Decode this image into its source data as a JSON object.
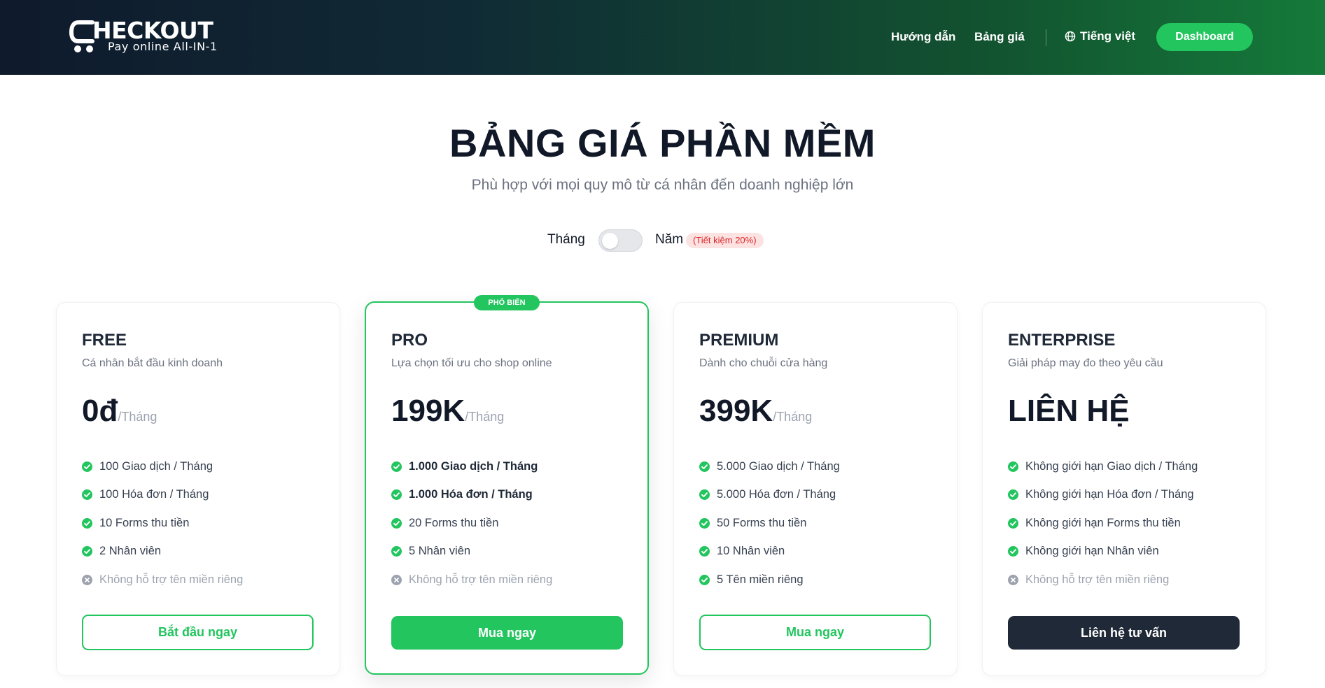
{
  "brand": {
    "wordmark": "HECKOUT",
    "tagline": "Pay online All-IN-1"
  },
  "nav": {
    "guide": "Hướng dẫn",
    "pricing": "Bảng giá",
    "language": "Tiếng việt",
    "dashboard": "Dashboard"
  },
  "hero": {
    "title": "BẢNG GIÁ PHẦN MỀM",
    "subtitle": "Phù hợp với mọi quy mô từ cá nhân đến doanh nghiệp lớn"
  },
  "billing": {
    "monthly_label": "Tháng",
    "yearly_label": "Năm",
    "savings_badge": "(Tiết kiệm 20%)",
    "toggle_state": "monthly"
  },
  "colors": {
    "accent": "#22c55e",
    "dark": "#1f2937",
    "header_start": "#0f1a2c",
    "header_end": "#157a3a"
  },
  "plans": [
    {
      "name": "FREE",
      "desc": "Cá nhân bắt đầu kinh doanh",
      "price": "0đ",
      "period": "/Tháng",
      "features": [
        {
          "text": "100 Giao dịch / Tháng",
          "included": true
        },
        {
          "text": "100 Hóa đơn / Tháng",
          "included": true
        },
        {
          "text": "10 Forms thu tiền",
          "included": true
        },
        {
          "text": "2 Nhân viên",
          "included": true
        },
        {
          "text": "Không hỗ trợ tên miền riêng",
          "included": false
        }
      ],
      "cta": "Bắt đầu ngay"
    },
    {
      "name": "PRO",
      "badge": "PHỔ BIẾN",
      "desc": "Lựa chọn tối ưu cho shop online",
      "price": "199K",
      "period": "/Tháng",
      "features": [
        {
          "text": "1.000 Giao dịch / Tháng",
          "included": true
        },
        {
          "text": "1.000 Hóa đơn / Tháng",
          "included": true
        },
        {
          "text": "20 Forms thu tiền",
          "included": true
        },
        {
          "text": "5 Nhân viên",
          "included": true
        },
        {
          "text": "Không hỗ trợ tên miền riêng",
          "included": false
        }
      ],
      "cta": "Mua ngay"
    },
    {
      "name": "PREMIUM",
      "desc": "Dành cho chuỗi cửa hàng",
      "price": "399K",
      "period": "/Tháng",
      "features": [
        {
          "text": "5.000 Giao dịch / Tháng",
          "included": true
        },
        {
          "text": "5.000 Hóa đơn / Tháng",
          "included": true
        },
        {
          "text": "50 Forms thu tiền",
          "included": true
        },
        {
          "text": "10 Nhân viên",
          "included": true
        },
        {
          "text": "5 Tên miền riêng",
          "included": true
        }
      ],
      "cta": "Mua ngay"
    },
    {
      "name": "ENTERPRISE",
      "desc": "Giải pháp may đo theo yêu cầu",
      "price": "LIÊN HỆ",
      "period": "",
      "features": [
        {
          "text": "Không giới hạn Giao dịch / Tháng",
          "included": true
        },
        {
          "text": "Không giới hạn Hóa đơn / Tháng",
          "included": true
        },
        {
          "text": "Không giới hạn Forms thu tiền",
          "included": true
        },
        {
          "text": "Không giới hạn Nhân viên",
          "included": true
        },
        {
          "text": "Không hỗ trợ tên miền riêng",
          "included": false
        }
      ],
      "cta": "Liên hệ tư vấn"
    }
  ]
}
